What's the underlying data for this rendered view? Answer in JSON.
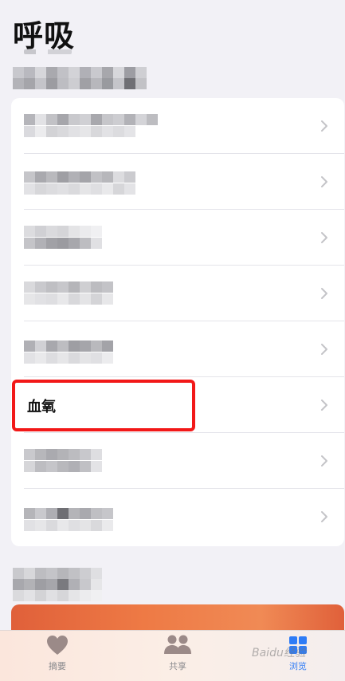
{
  "page": {
    "title": "呼吸"
  },
  "list": {
    "highlighted_label": "血氧"
  },
  "tabbar": {
    "tabs": [
      {
        "label": "摘要",
        "icon": "heart-icon",
        "active": false
      },
      {
        "label": "共享",
        "icon": "people-icon",
        "active": false
      },
      {
        "label": "浏览",
        "icon": "grid-icon",
        "active": true
      }
    ]
  },
  "colors": {
    "accent": "#2f7cf6",
    "highlight_border": "#f21818",
    "background": "#f2f1f6"
  },
  "watermark": "Baidu经验"
}
